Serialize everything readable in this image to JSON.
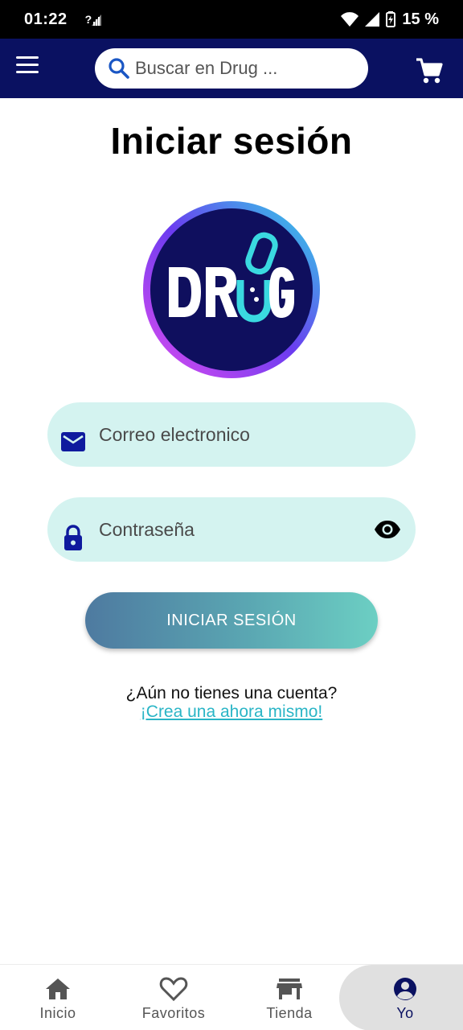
{
  "status_bar": {
    "time": "01:22",
    "sim": "?",
    "battery": "15 %"
  },
  "app_bar": {
    "search_placeholder": "Buscar en Drug ...",
    "color": "#0a1161"
  },
  "page": {
    "title": "Iniciar sesión"
  },
  "logo": {
    "text": "DRUG"
  },
  "form": {
    "email_placeholder": "Correo electronico",
    "password_placeholder": "Contraseña",
    "login_label": "INICIAR SESIÓN"
  },
  "signup": {
    "prompt": "¿Aún no tienes una cuenta?",
    "link": "¡Crea una ahora mismo!"
  },
  "bottom_nav": {
    "items": [
      {
        "label": "Inicio",
        "icon": "home-icon"
      },
      {
        "label": "Favoritos",
        "icon": "heart-icon"
      },
      {
        "label": "Tienda",
        "icon": "store-icon"
      },
      {
        "label": "Yo",
        "icon": "account-icon",
        "active": true
      }
    ]
  },
  "colors": {
    "accent": "#2ab5c6",
    "field_bg": "#d4f3f0",
    "icon_blue": "#0f1a9e"
  }
}
